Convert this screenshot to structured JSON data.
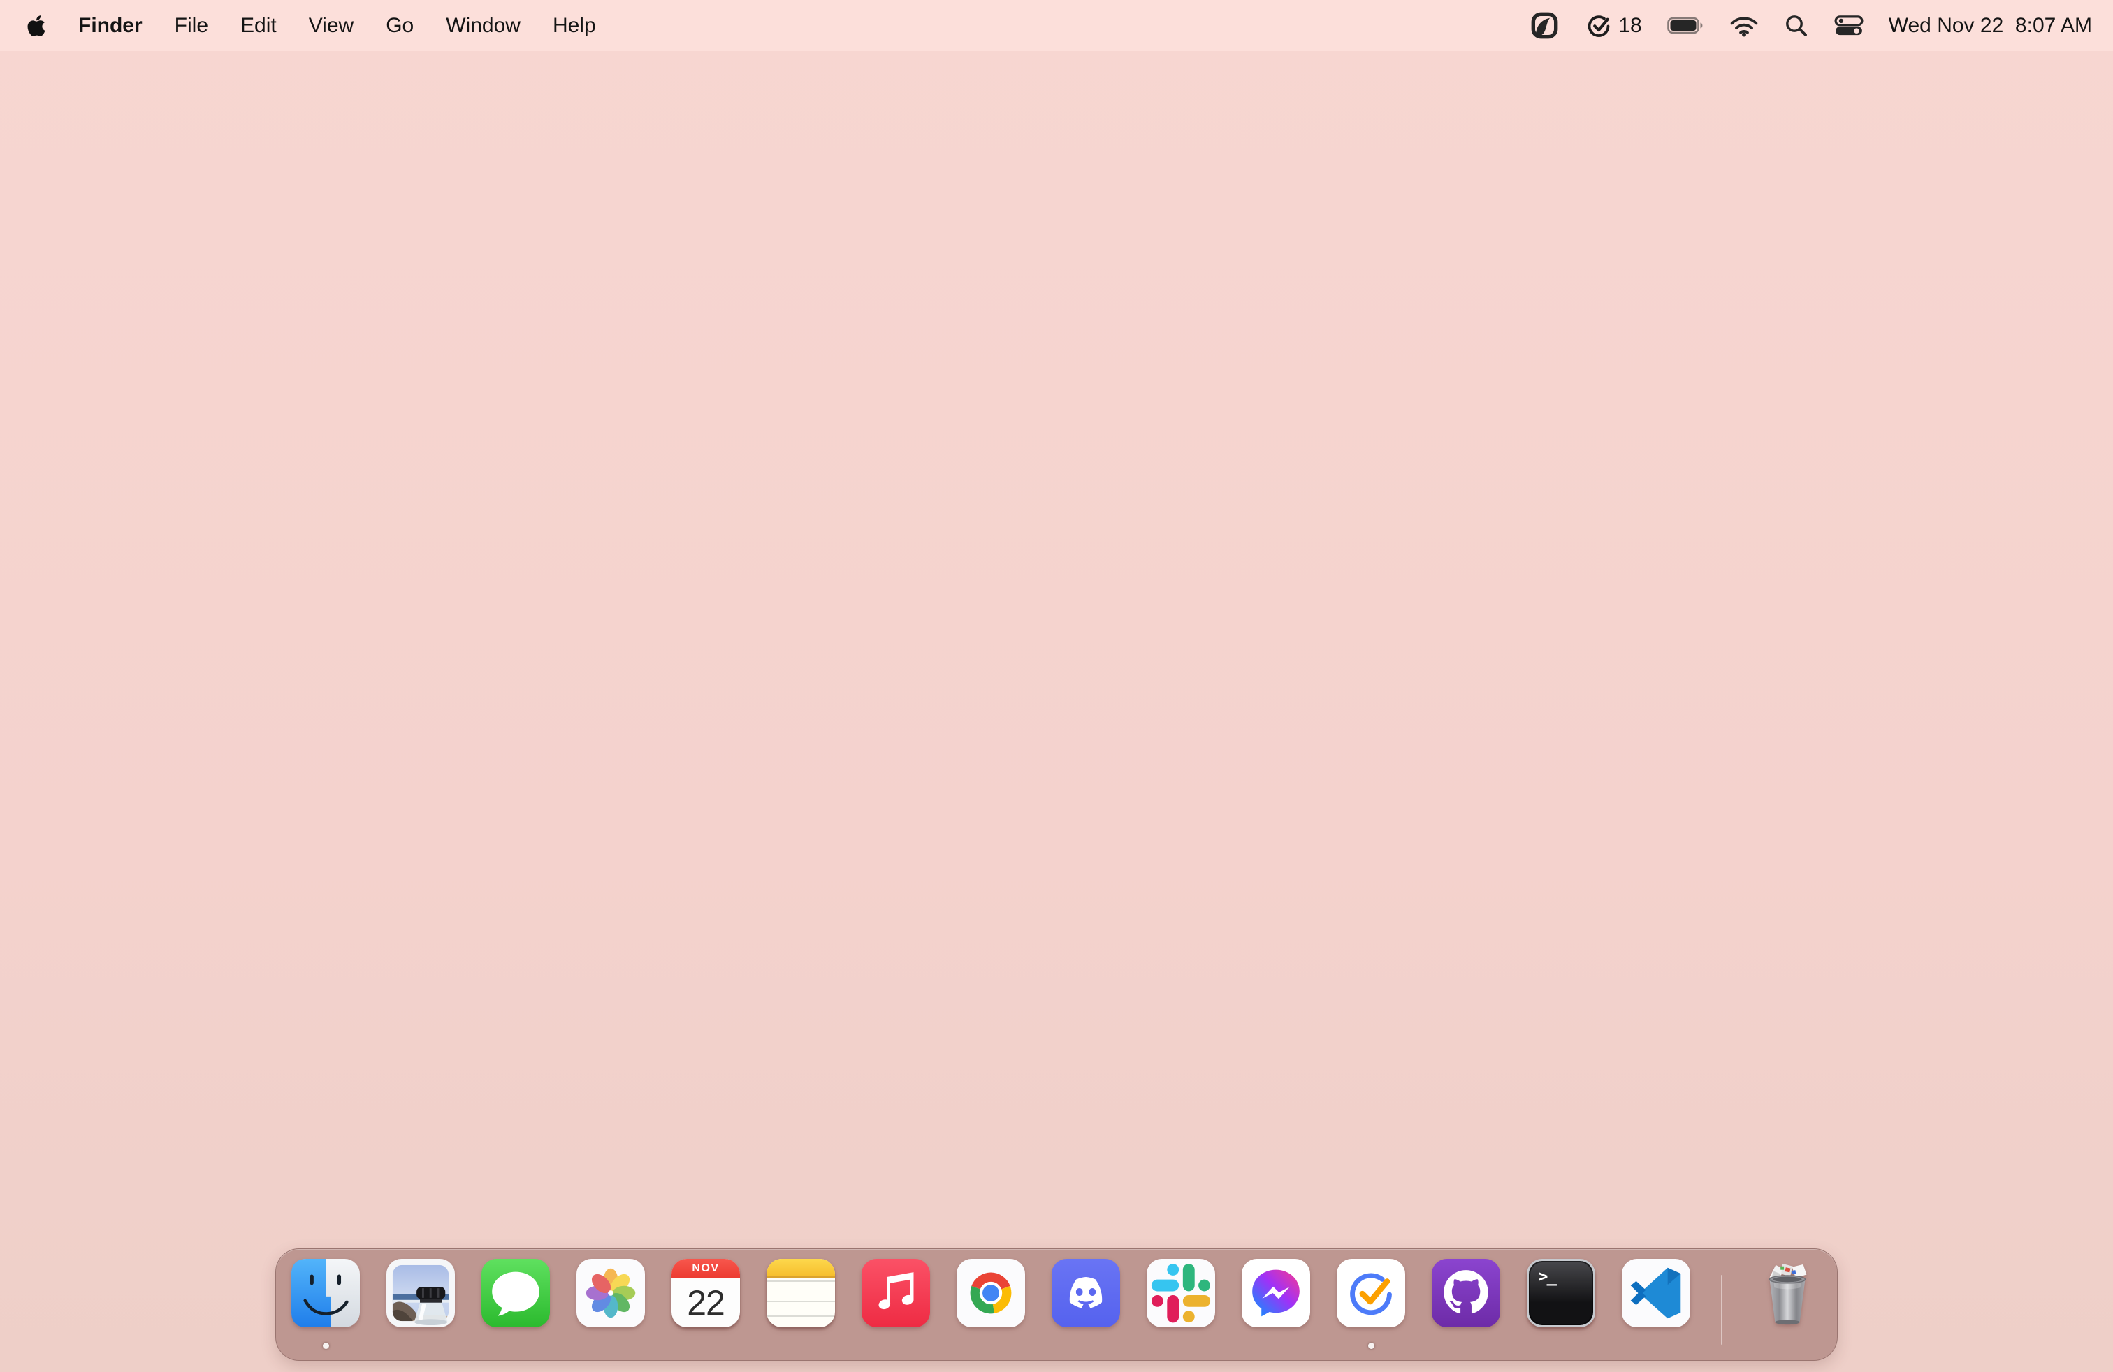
{
  "menu_bar": {
    "active_app": "Finder",
    "menus": [
      "File",
      "Edit",
      "View",
      "Go",
      "Window",
      "Help"
    ],
    "status_icons": [
      "pick-shape-icon",
      "task-check-icon",
      "battery-icon",
      "wifi-icon",
      "spotlight-icon",
      "control-center-icon"
    ],
    "badge_count": "18",
    "clock": "Wed Nov 22  8:07 AM"
  },
  "dock": {
    "apps": [
      {
        "name": "Finder",
        "running": true
      },
      {
        "name": "Preview",
        "running": false
      },
      {
        "name": "Messages",
        "running": false
      },
      {
        "name": "Photos",
        "running": false
      },
      {
        "name": "Calendar",
        "running": false
      },
      {
        "name": "Notes",
        "running": false
      },
      {
        "name": "Music",
        "running": false
      },
      {
        "name": "Google Chrome",
        "running": false
      },
      {
        "name": "Discord",
        "running": false
      },
      {
        "name": "Slack",
        "running": false
      },
      {
        "name": "Messenger",
        "running": false
      },
      {
        "name": "TickTick",
        "running": true
      },
      {
        "name": "GitHub Desktop",
        "running": false
      },
      {
        "name": "Terminal",
        "running": false
      },
      {
        "name": "Visual Studio Code",
        "running": false
      },
      {
        "name": "Trash",
        "running": false
      }
    ],
    "calendar_icon": {
      "month": "NOV",
      "day": "22"
    },
    "terminal_icon": {
      "prompt": ">_"
    }
  },
  "colors": {
    "menu_bar_bg": "#fcdfda",
    "wallpaper_top": "#f7d6d1",
    "wallpaper_bottom": "#eecfc8",
    "dock_bg": "rgba(187,148,142,0.95)",
    "calendar_red": "#ee4237",
    "notes_yellow": "#f8c93c"
  }
}
